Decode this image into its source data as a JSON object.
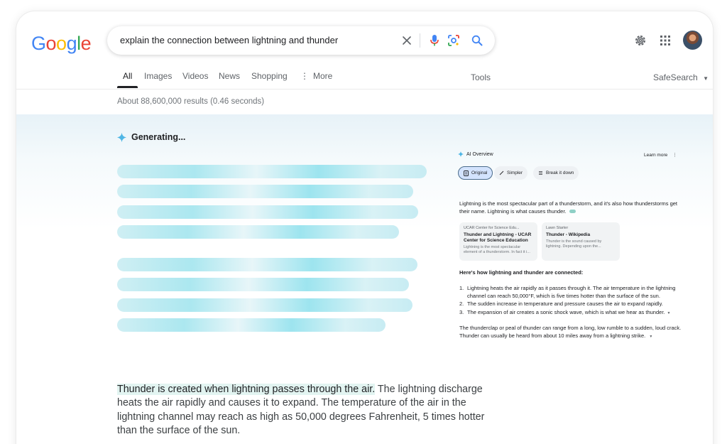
{
  "brand": {
    "logo_letters": [
      "G",
      "o",
      "o",
      "g",
      "l",
      "e"
    ]
  },
  "search": {
    "query": "explain the connection between lightning and thunder"
  },
  "tabs": [
    {
      "label": "All"
    },
    {
      "label": "Images"
    },
    {
      "label": "Videos"
    },
    {
      "label": "News"
    },
    {
      "label": "Shopping"
    },
    {
      "label": "More"
    }
  ],
  "tools_label": "Tools",
  "safesearch_label": "SafeSearch",
  "result_stats": "About 88,600,000 results (0.46 seconds)",
  "generating_label": "Generating...",
  "ai_overview": {
    "title": "AI Overview",
    "learn_more": "Learn more",
    "chips": [
      {
        "label": "Original",
        "selected": true
      },
      {
        "label": "Simpler",
        "selected": false
      },
      {
        "label": "Break it down",
        "selected": false
      }
    ],
    "intro": "Lightning is the most spectacular part of a thunderstorm, and it's also how thunderstorms get their name. Lightning is what causes thunder.",
    "sources": [
      {
        "site": "UCAR Center for Science Edu...",
        "title": "Thunder and Lightning - UCAR Center for Science Education",
        "snippet": "Lightning is the most spectacular element of a thunderstorm. In fact it i..."
      },
      {
        "site": "Lawn Starter",
        "title": "Thunder - Wikipedia",
        "snippet": "Thunder is the sound caused by lightning. Depending upon the..."
      }
    ],
    "subheading": "Here's how lightning and thunder are connected:",
    "steps": [
      {
        "num": "1.",
        "text": "Lightning heats the air rapidly as it passes through it. The air temperature in the lightning channel can reach 50,000°F, which is five times hotter than the surface of the sun."
      },
      {
        "num": "2.",
        "text": "The sudden increase in temperature and pressure causes the air to expand rapidly."
      },
      {
        "num": "3.",
        "text": "The expansion of air creates a sonic shock wave, which is what we hear as thunder."
      }
    ],
    "closing": "The thunderclap or peal of thunder can range from a long, low rumble to a sudden, loud crack. Thunder can usually be heard from about 10 miles away from a lightning strike."
  },
  "answer": {
    "highlight": "Thunder is created when lightning passes through the air.",
    "rest": " The lightning discharge heats the air rapidly and causes it to expand. The temperature of the air in the lightning channel may reach as high as 50,000 degrees Fahrenheit, 5 times hotter than the surface of the sun."
  },
  "colors": {
    "google_blue": "#4285F4",
    "google_red": "#EA4335",
    "google_yellow": "#FBBC05",
    "google_green": "#34A853",
    "accent_teal": "#6fd3e3"
  }
}
